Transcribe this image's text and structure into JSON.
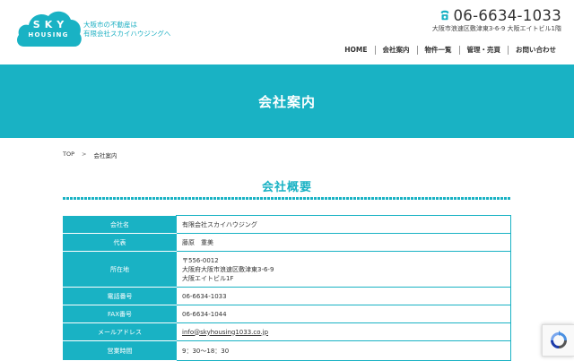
{
  "header": {
    "logo": {
      "line1": "SKY",
      "line2": "HOUSING"
    },
    "tagline": [
      "大阪市の不動産は",
      "有限会社スカイハウジングへ"
    ],
    "phone": "06-6634-1033",
    "address": "大阪市浪速区敷津東3-6-9 大阪エイトビル1階",
    "nav": [
      "HOME",
      "会社案内",
      "物件一覧",
      "管理・売買",
      "お問い合わせ"
    ]
  },
  "banner": {
    "title": "会社案内"
  },
  "breadcrumb": {
    "home": "TOP",
    "sep": ">",
    "current": "会社案内"
  },
  "section": {
    "title": "会社概要"
  },
  "company": {
    "rows": [
      {
        "label": "会社名",
        "value": "有限会社スカイハウジング"
      },
      {
        "label": "代表",
        "value": "藤原　重美"
      },
      {
        "label": "所在地",
        "lines": [
          "〒556-0012",
          "大阪府大阪市浪速区敷津東3-6-9",
          "大阪エイトビル1F"
        ]
      },
      {
        "label": "電話番号",
        "value": "06-6634-1033"
      },
      {
        "label": "FAX番号",
        "value": "06-6634-1044"
      },
      {
        "label": "メールアドレス",
        "value": "info@skyhousing1033.co.jp"
      },
      {
        "label": "営業時間",
        "value": "9：30〜18：30"
      }
    ]
  },
  "colors": {
    "accent": "#19b2c4",
    "text": "#333333"
  },
  "icons": {
    "phone": "phone-icon",
    "recaptcha": "recaptcha-icon",
    "logo": "cloud-logo"
  }
}
